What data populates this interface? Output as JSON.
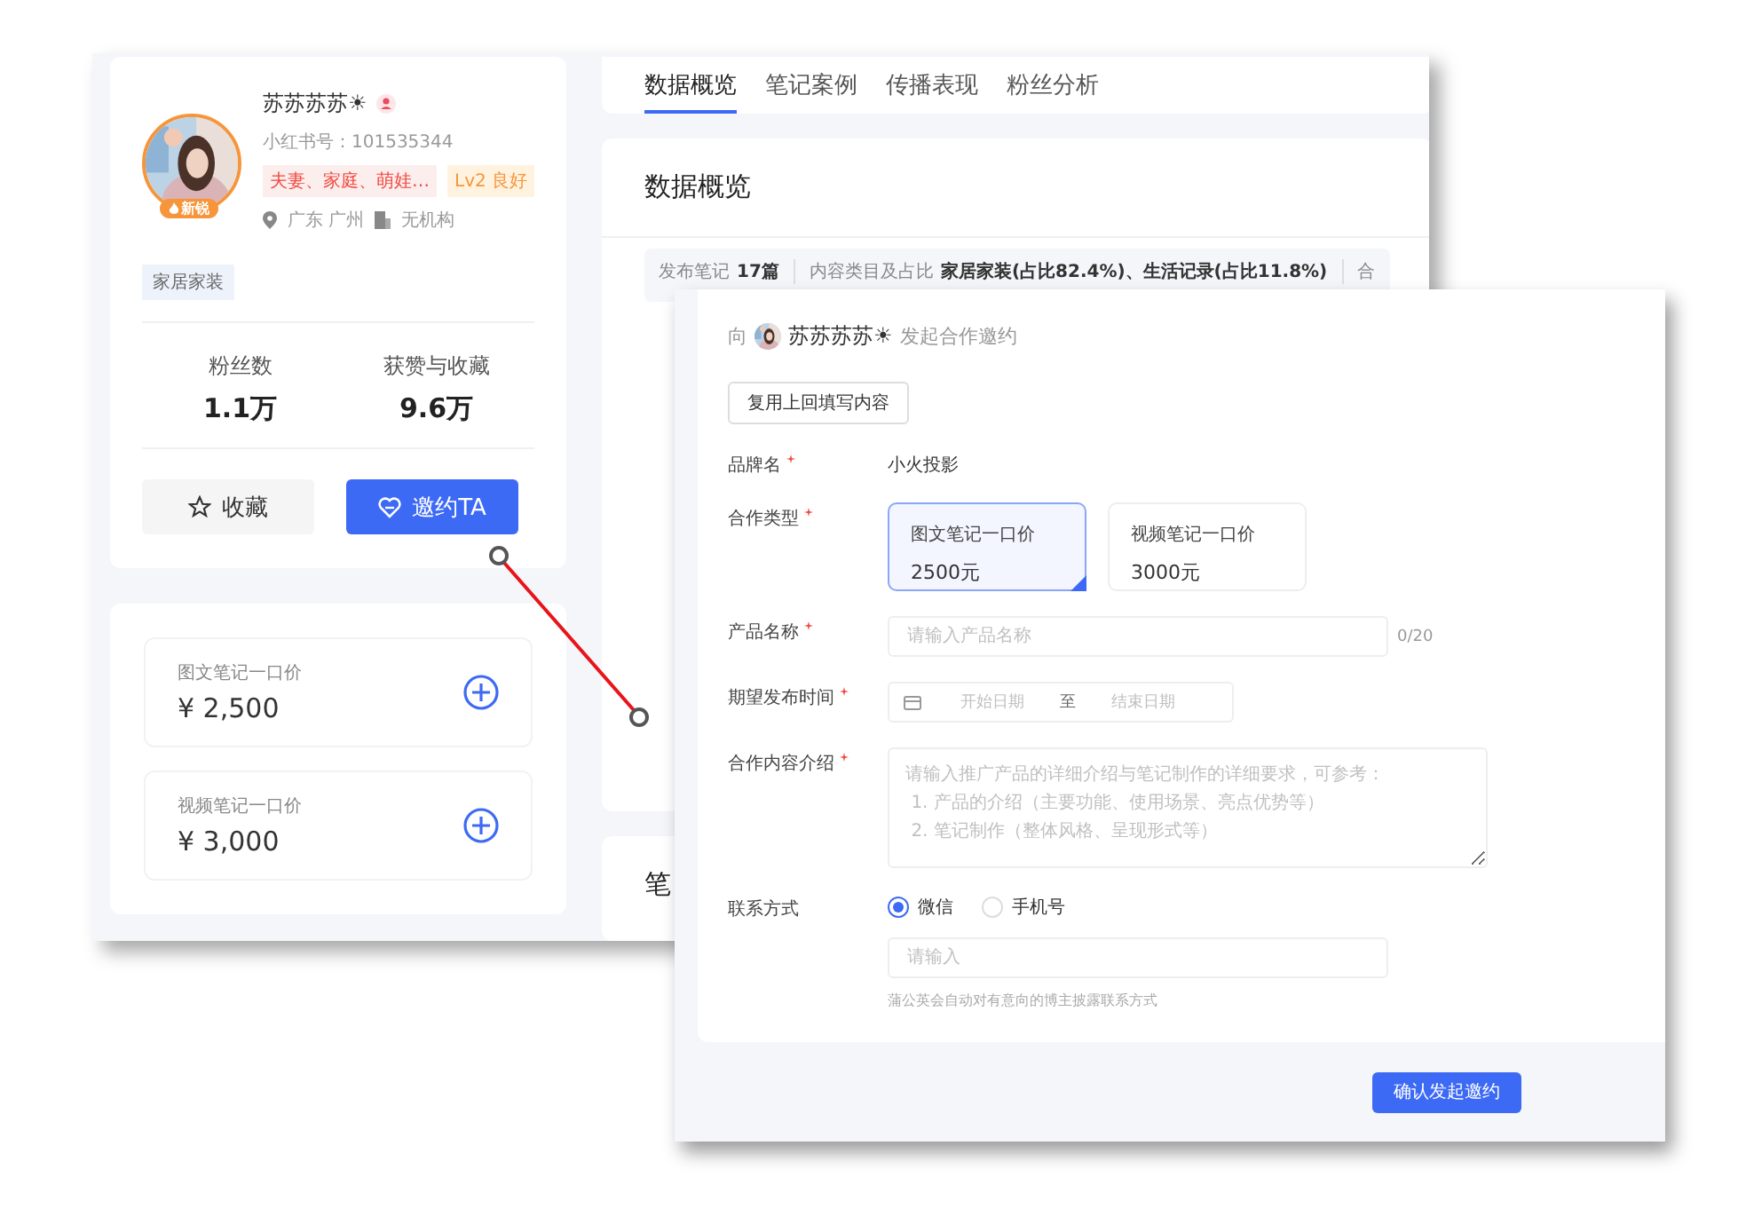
{
  "profile": {
    "name": "苏苏苏苏☀",
    "id_text": "小红书号：101535344",
    "badge": "新锐",
    "tags": [
      {
        "text": "夫妻、家庭、萌娃…",
        "kind": "category"
      },
      {
        "text": "Lv2 良好",
        "kind": "level"
      }
    ],
    "location": "广东 广州",
    "org": "无机构",
    "field": "家居家装",
    "stats": [
      {
        "label": "粉丝数",
        "value": "1.1万"
      },
      {
        "label": "获赞与收藏",
        "value": "9.6万"
      }
    ],
    "buttons": [
      {
        "label": "收藏",
        "kind": "secondary"
      },
      {
        "label": "邀约TA",
        "kind": "primary"
      }
    ]
  },
  "prices": [
    {
      "label": "图文笔记一口价",
      "value": "¥ 2,500"
    },
    {
      "label": "视频笔记一口价",
      "value": "¥ 3,000"
    }
  ],
  "tabs": [
    {
      "label": "数据概览",
      "selected": true
    },
    {
      "label": "笔记案例",
      "selected": false
    },
    {
      "label": "传播表现",
      "selected": false
    },
    {
      "label": "粉丝分析",
      "selected": false
    }
  ],
  "overview": {
    "title": "数据概览",
    "stats": [
      {
        "label": "发布笔记",
        "value": "17篇"
      },
      {
        "label": "内容类目及占比",
        "value": "家居家装(占比82.4%)、生活记录(占比11.8%)"
      },
      {
        "label": "合"
      }
    ]
  },
  "next_section_title": "笔",
  "dialog": {
    "title_prefix": "向",
    "user": "苏苏苏苏☀",
    "title_suffix": "发起合作邀约",
    "reuse_button": "复用上回填写内容",
    "rows": [
      {
        "kind": "text",
        "label": "品牌名",
        "required": true,
        "value": "小火投影"
      },
      {
        "kind": "options",
        "label": "合作类型",
        "required": true,
        "options": [
          {
            "title": "图文笔记一口价",
            "price": "2500元",
            "selected": true
          },
          {
            "title": "视频笔记一口价",
            "price": "3000元",
            "selected": false
          }
        ]
      },
      {
        "kind": "input",
        "label": "产品名称",
        "required": true,
        "placeholder": "请输入产品名称",
        "counter": "0/20"
      },
      {
        "kind": "daterange",
        "label": "期望发布时间",
        "required": true,
        "start": "开始日期",
        "separator": "至",
        "end": "结束日期"
      },
      {
        "kind": "textarea",
        "label": "合作内容介绍",
        "required": true,
        "placeholder": "请输入推广产品的详细介绍与笔记制作的详细要求，可参考：\n 1. 产品的介绍（主要功能、使用场景、亮点优势等）\n 2. 笔记制作（整体风格、呈现形式等）"
      },
      {
        "kind": "contact",
        "label": "联系方式",
        "required": false,
        "options": [
          {
            "label": "微信",
            "selected": true
          },
          {
            "label": "手机号",
            "selected": false
          }
        ],
        "placeholder": "请输入",
        "hint": "蒲公英会自动对有意向的博主披露联系方式"
      }
    ],
    "submit": "确认发起邀约"
  }
}
